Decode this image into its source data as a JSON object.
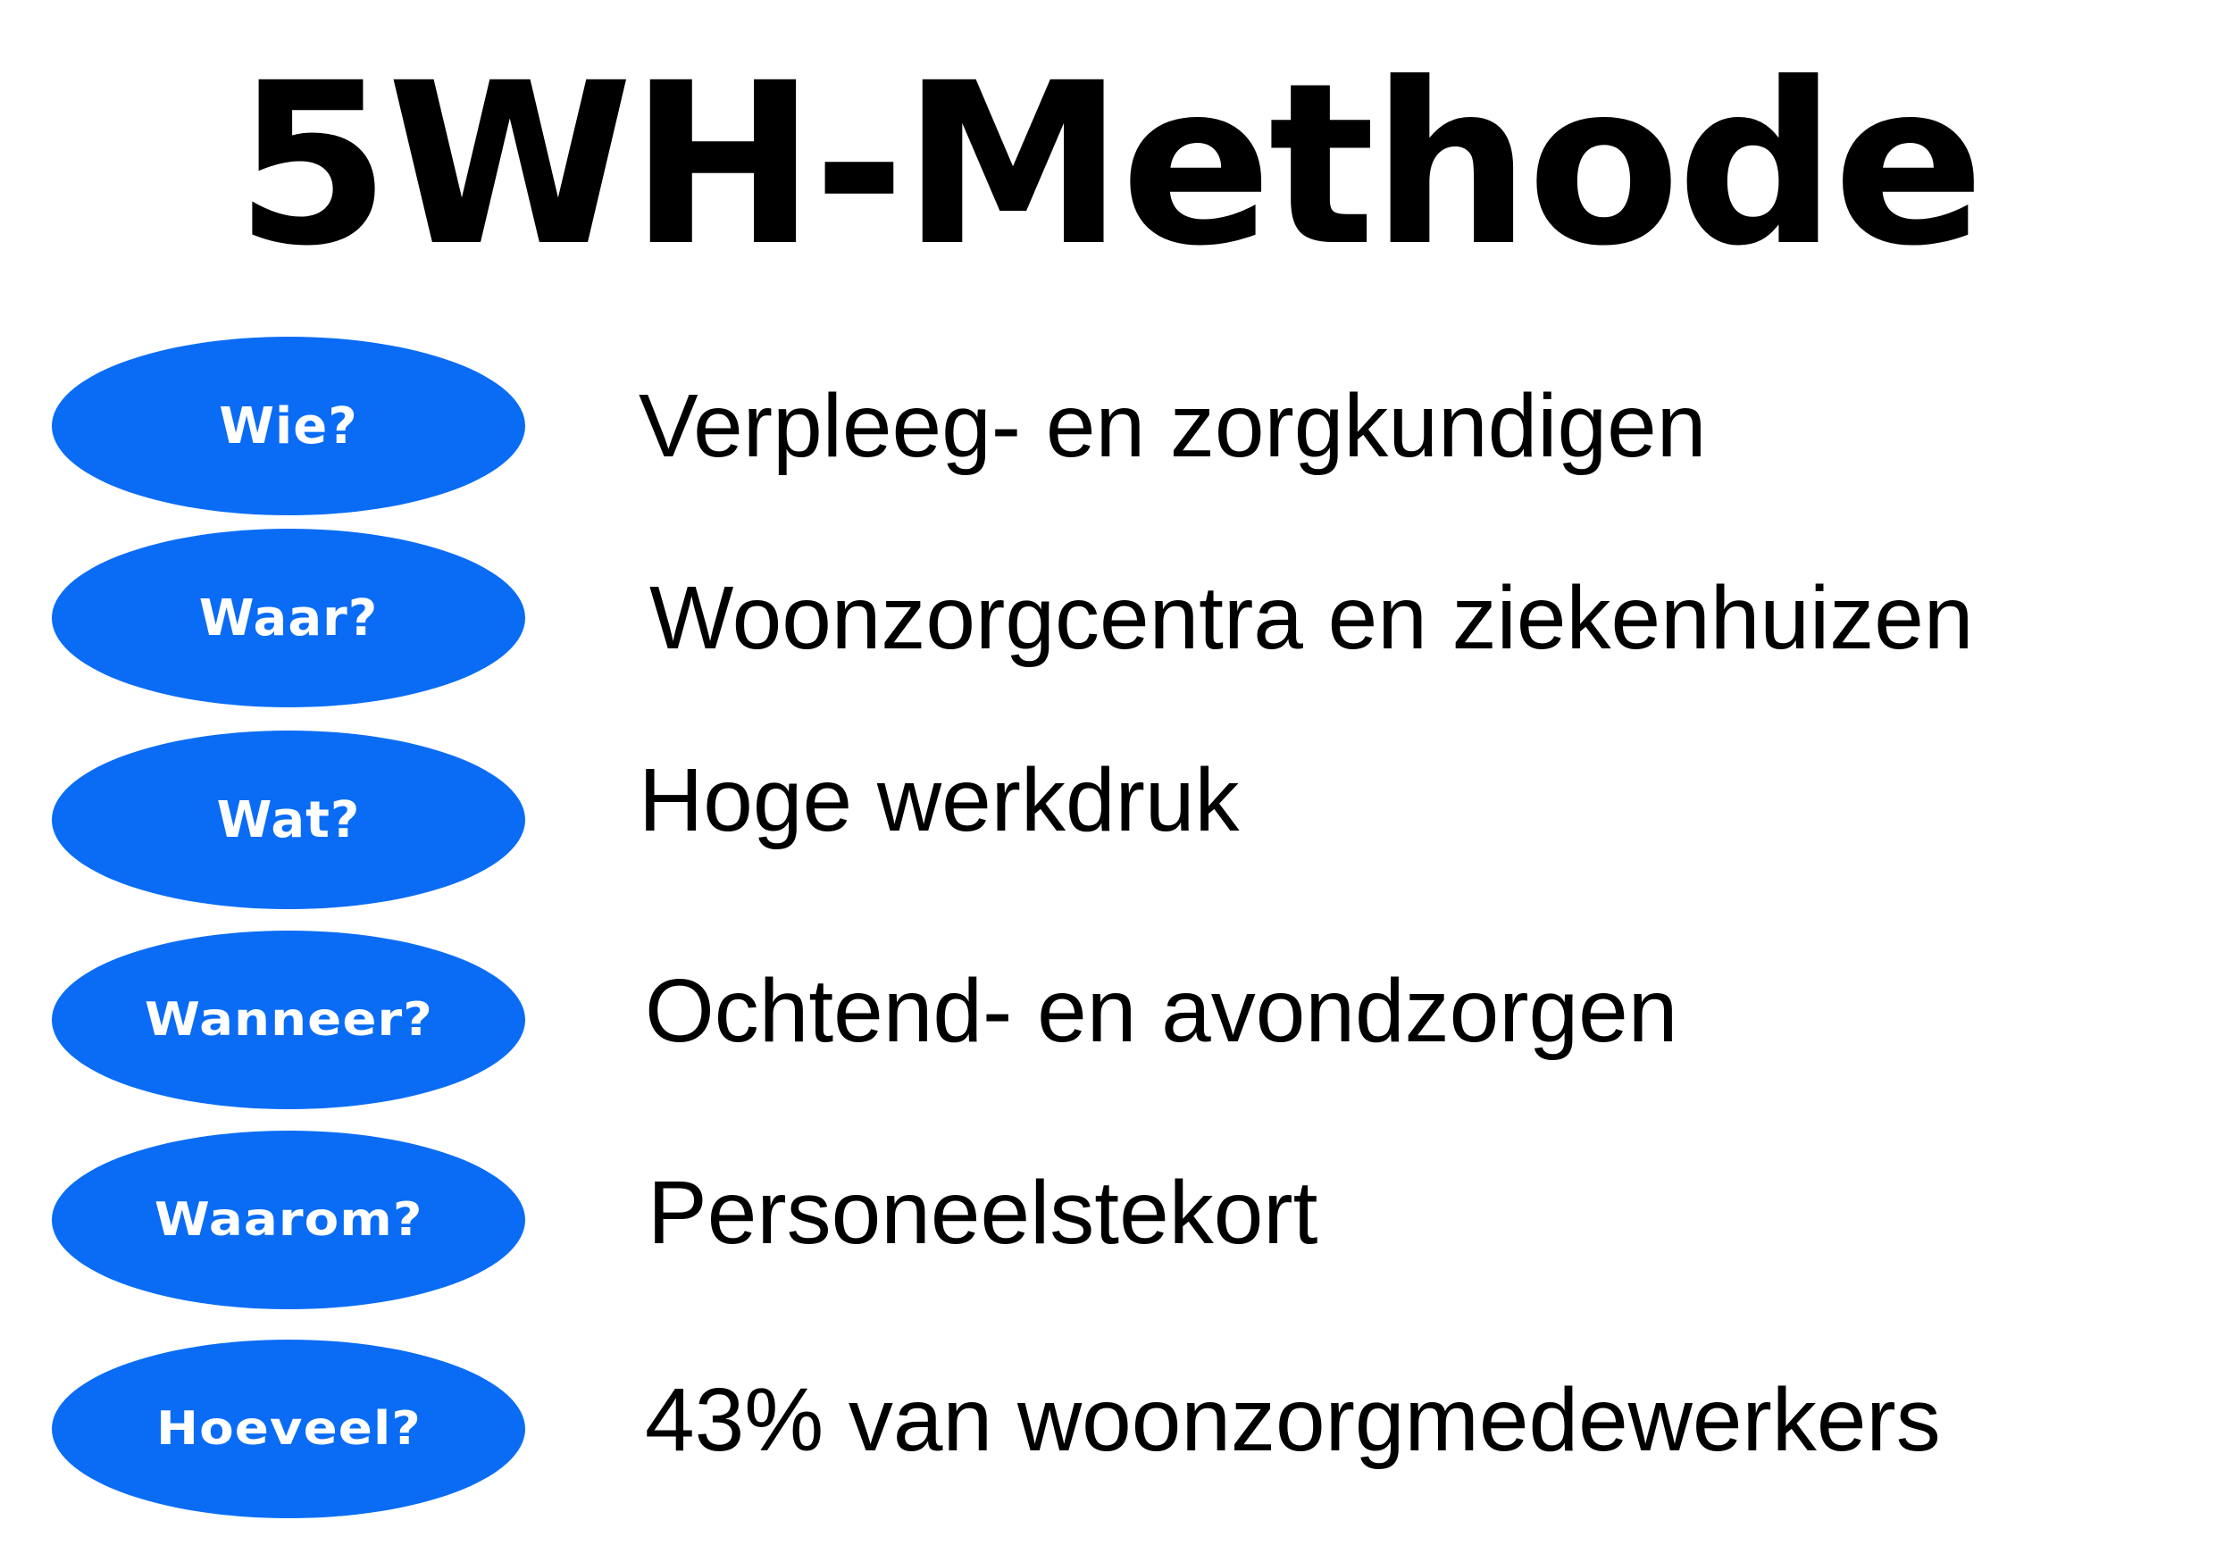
{
  "title": "5WH-Methode",
  "colors": {
    "oval_fill": "#0a6cf5",
    "oval_text": "#ffffff",
    "text": "#000000",
    "background": "#ffffff"
  },
  "rows": [
    {
      "question": "Wie?",
      "answer": "Verpleeg- en zorgkundigen"
    },
    {
      "question": "Waar?",
      "answer": "Woonzorgcentra en ziekenhuizen"
    },
    {
      "question": "Wat?",
      "answer": "Hoge werkdruk"
    },
    {
      "question": "Wanneer?",
      "answer": "Ochtend- en avondzorgen"
    },
    {
      "question": "Waarom?",
      "answer": "Personeelstekort"
    },
    {
      "question": "Hoeveel?",
      "answer": "43% van woonzorgmedewerkers"
    }
  ]
}
